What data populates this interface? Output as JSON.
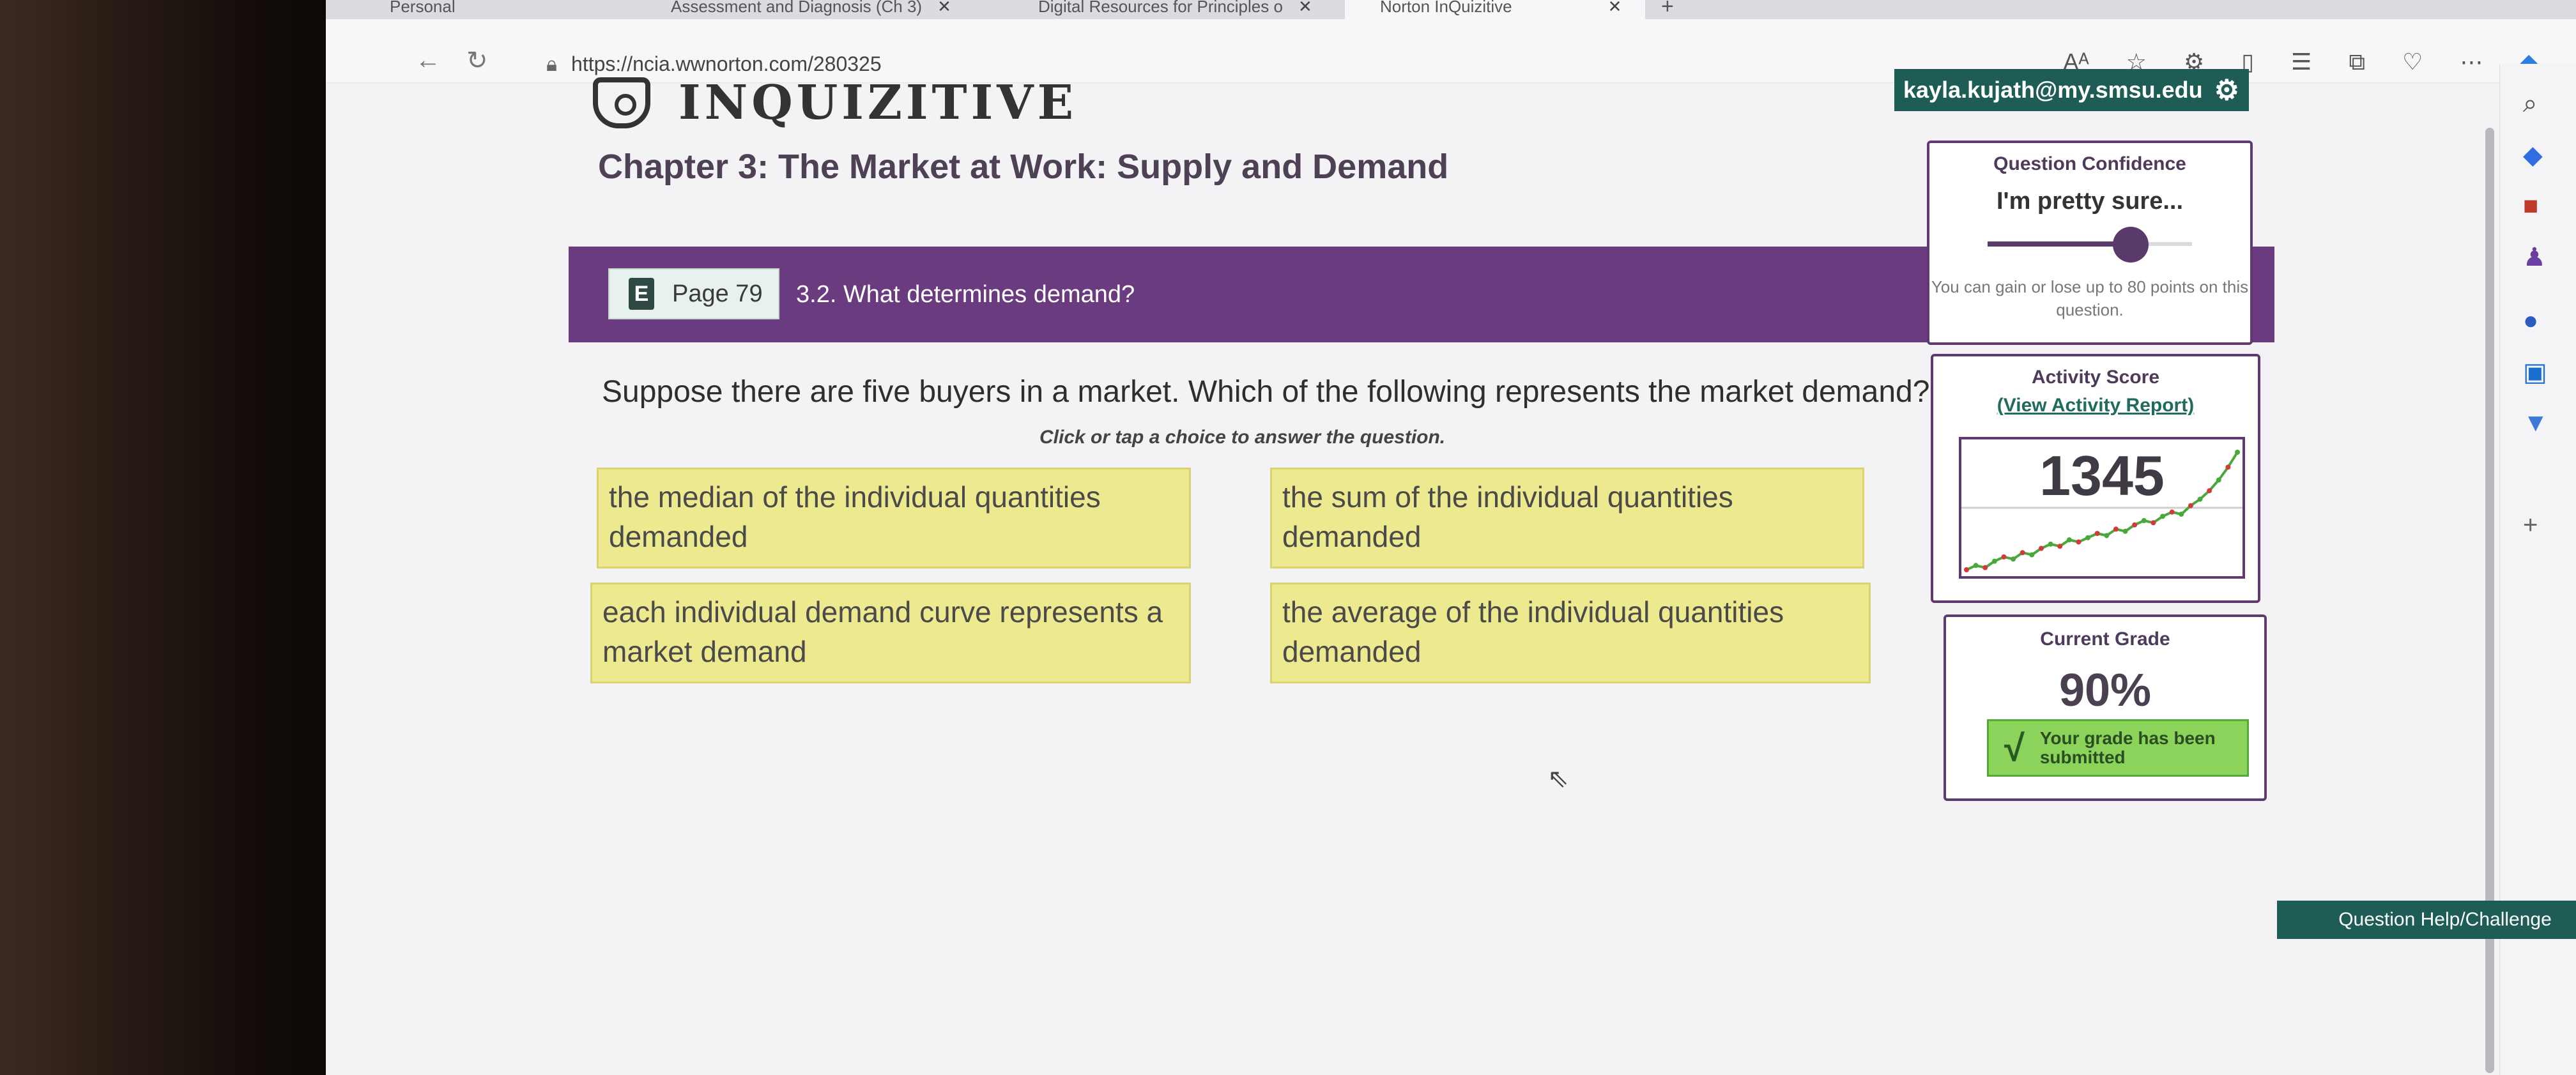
{
  "browser": {
    "tabs": [
      {
        "label": "Personal"
      },
      {
        "label": "Assessment and Diagnosis (Ch 3)"
      },
      {
        "label": "Digital Resources for Principles o"
      },
      {
        "label": "Norton InQuizitive"
      }
    ],
    "url": "https://ncia.wwnorton.com/280325",
    "reader_icon_text": "Aᴬ"
  },
  "app": {
    "logo_text": "INQUIZITIVE",
    "user_email": "kayla.kujath@my.smsu.edu"
  },
  "chapter_title": "Chapter 3: The Market at Work: Supply and Demand",
  "page_ref": {
    "label": "Page 79",
    "icon_letter": "E"
  },
  "section": "3.2. What determines demand?",
  "question": {
    "text": "Suppose there are five buyers in a market. Which of the following represents the market demand?",
    "instruction": "Click or tap a choice to answer the question.",
    "choices": [
      "the median of the individual quantities demanded",
      "the sum of the individual quantities demanded",
      "each individual demand curve represents a market demand",
      "the average of the individual quantities demanded"
    ]
  },
  "confidence": {
    "title": "Question Confidence",
    "value_label": "I'm pretty sure...",
    "level": 0.7,
    "note": "You can gain or lose up to 80 points on this question."
  },
  "activity": {
    "title": "Activity Score",
    "report_link": "(View Activity Report)",
    "score": "1345",
    "trend": [
      0,
      2,
      1,
      4,
      6,
      5,
      8,
      7,
      10,
      12,
      11,
      14,
      13,
      15,
      17,
      16,
      19,
      18,
      21,
      23,
      22,
      25,
      27,
      26,
      30,
      33,
      37,
      42,
      48,
      55
    ]
  },
  "grade": {
    "title": "Current Grade",
    "value": "90%",
    "status": "Your grade has been submitted"
  },
  "help_button": "Question Help/Challenge",
  "colors": {
    "purple": "#6b3b80",
    "teal": "#1d5d55",
    "choice_bg": "#ece98f",
    "graph_line": "#4aa83a",
    "graph_dots": "#d23b3b"
  }
}
